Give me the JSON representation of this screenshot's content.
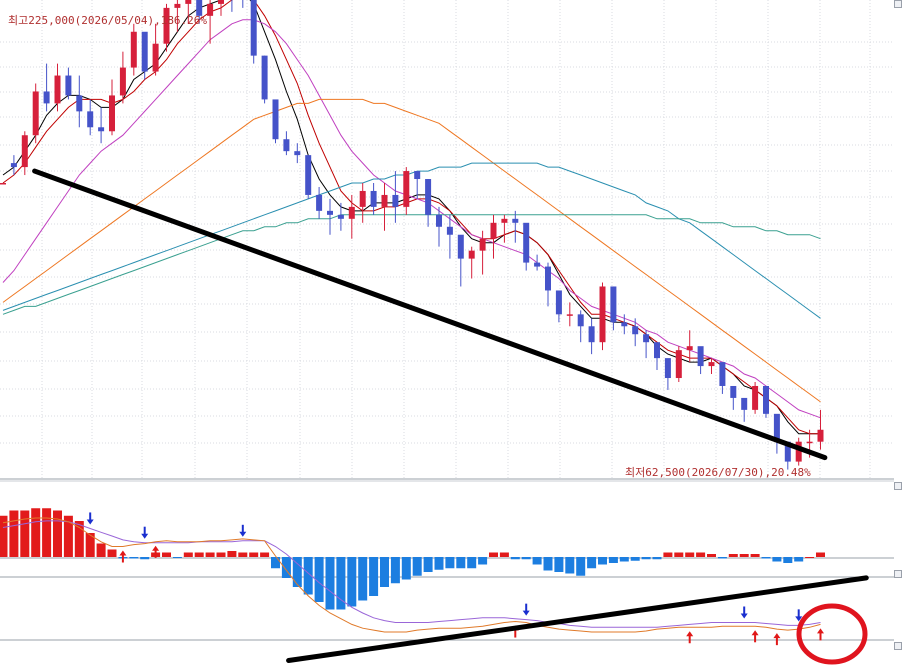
{
  "chart_data": [
    {
      "type": "candlestick",
      "annotations": {
        "high_label": "최고225,000(2026/05/04),186.26%",
        "low_label": "최저62,500(2026/07/30),20.48%"
      },
      "candles": [
        [
          0.0,
          0.0,
          0.0,
          0.0
        ],
        [
          0.05,
          0.07,
          0.02,
          0.04
        ],
        [
          0.04,
          0.13,
          0.02,
          0.12
        ],
        [
          0.12,
          0.25,
          0.1,
          0.23
        ],
        [
          0.23,
          0.3,
          0.18,
          0.2
        ],
        [
          0.2,
          0.3,
          0.18,
          0.27
        ],
        [
          0.27,
          0.29,
          0.21,
          0.22
        ],
        [
          0.22,
          0.27,
          0.14,
          0.18
        ],
        [
          0.18,
          0.21,
          0.12,
          0.14
        ],
        [
          0.14,
          0.19,
          0.1,
          0.13
        ],
        [
          0.13,
          0.26,
          0.12,
          0.22
        ],
        [
          0.22,
          0.33,
          0.2,
          0.29
        ],
        [
          0.29,
          0.4,
          0.27,
          0.38
        ],
        [
          0.38,
          0.37,
          0.26,
          0.28
        ],
        [
          0.28,
          0.4,
          0.27,
          0.35
        ],
        [
          0.35,
          0.45,
          0.33,
          0.44
        ],
        [
          0.44,
          0.48,
          0.38,
          0.45
        ],
        [
          0.45,
          0.49,
          0.4,
          0.47
        ],
        [
          0.47,
          0.5,
          0.4,
          0.42
        ],
        [
          0.42,
          0.46,
          0.35,
          0.45
        ],
        [
          0.45,
          0.56,
          0.42,
          0.51
        ],
        [
          0.51,
          0.51,
          0.43,
          0.48
        ],
        [
          0.48,
          0.5,
          0.44,
          0.46
        ],
        [
          0.46,
          0.44,
          0.3,
          0.32
        ],
        [
          0.32,
          0.32,
          0.2,
          0.21
        ],
        [
          0.21,
          0.19,
          0.1,
          0.11
        ],
        [
          0.11,
          0.13,
          0.07,
          0.08
        ],
        [
          0.08,
          0.1,
          0.05,
          0.07
        ],
        [
          0.07,
          0.07,
          -0.04,
          -0.03
        ],
        [
          -0.03,
          -0.01,
          -0.09,
          -0.07
        ],
        [
          -0.07,
          -0.04,
          -0.13,
          -0.08
        ],
        [
          -0.08,
          -0.05,
          -0.12,
          -0.09
        ],
        [
          -0.09,
          -0.03,
          -0.14,
          -0.06
        ],
        [
          -0.06,
          0.0,
          -0.1,
          -0.02
        ],
        [
          -0.02,
          0.0,
          -0.08,
          -0.06
        ],
        [
          -0.06,
          0.0,
          -0.12,
          -0.03
        ],
        [
          -0.03,
          0.03,
          -0.1,
          -0.06
        ],
        [
          -0.06,
          0.04,
          -0.08,
          0.03
        ],
        [
          0.03,
          0.02,
          -0.04,
          0.01
        ],
        [
          0.01,
          0.01,
          -0.11,
          -0.08
        ],
        [
          -0.08,
          -0.06,
          -0.16,
          -0.11
        ],
        [
          -0.11,
          -0.08,
          -0.19,
          -0.13
        ],
        [
          -0.13,
          -0.17,
          -0.26,
          -0.19
        ],
        [
          -0.19,
          -0.16,
          -0.24,
          -0.17
        ],
        [
          -0.17,
          -0.12,
          -0.23,
          -0.14
        ],
        [
          -0.14,
          -0.08,
          -0.19,
          -0.1
        ],
        [
          -0.1,
          -0.08,
          -0.15,
          -0.09
        ],
        [
          -0.09,
          -0.07,
          -0.15,
          -0.1
        ],
        [
          -0.1,
          -0.12,
          -0.22,
          -0.2
        ],
        [
          -0.2,
          -0.18,
          -0.22,
          -0.21
        ],
        [
          -0.21,
          -0.2,
          -0.31,
          -0.27
        ],
        [
          -0.27,
          -0.28,
          -0.35,
          -0.33
        ],
        [
          -0.33,
          -0.3,
          -0.36,
          -0.33
        ],
        [
          -0.33,
          -0.32,
          -0.4,
          -0.36
        ],
        [
          -0.36,
          -0.34,
          -0.43,
          -0.4
        ],
        [
          -0.4,
          -0.25,
          -0.42,
          -0.26
        ],
        [
          -0.26,
          -0.26,
          -0.37,
          -0.35
        ],
        [
          -0.35,
          -0.33,
          -0.38,
          -0.36
        ],
        [
          -0.36,
          -0.34,
          -0.41,
          -0.38
        ],
        [
          -0.38,
          -0.37,
          -0.44,
          -0.4
        ],
        [
          -0.4,
          -0.41,
          -0.47,
          -0.44
        ],
        [
          -0.44,
          -0.45,
          -0.52,
          -0.49
        ],
        [
          -0.49,
          -0.41,
          -0.5,
          -0.42
        ],
        [
          -0.42,
          -0.37,
          -0.45,
          -0.41
        ],
        [
          -0.41,
          -0.42,
          -0.48,
          -0.46
        ],
        [
          -0.46,
          -0.44,
          -0.48,
          -0.45
        ],
        [
          -0.45,
          -0.48,
          -0.53,
          -0.51
        ],
        [
          -0.51,
          -0.53,
          -0.57,
          -0.54
        ],
        [
          -0.54,
          -0.55,
          -0.6,
          -0.57
        ],
        [
          -0.57,
          -0.5,
          -0.58,
          -0.51
        ],
        [
          -0.51,
          -0.51,
          -0.59,
          -0.58
        ],
        [
          -0.58,
          -0.59,
          -0.68,
          -0.65
        ],
        [
          -0.65,
          -0.65,
          -0.72,
          -0.7
        ],
        [
          -0.7,
          -0.64,
          -0.71,
          -0.65
        ],
        [
          -0.65,
          -0.62,
          -0.69,
          -0.65
        ],
        [
          -0.65,
          -0.57,
          -0.67,
          -0.62
        ]
      ],
      "moving_averages": [
        {
          "color": "#000000",
          "values": [
            0.02,
            0.04,
            0.08,
            0.12,
            0.17,
            0.2,
            0.22,
            0.22,
            0.21,
            0.19,
            0.19,
            0.21,
            0.26,
            0.28,
            0.3,
            0.34,
            0.38,
            0.42,
            0.44,
            0.45,
            0.46,
            0.47,
            0.48,
            0.45,
            0.38,
            0.31,
            0.23,
            0.16,
            0.07,
            0.01,
            -0.03,
            -0.06,
            -0.07,
            -0.07,
            -0.05,
            -0.05,
            -0.05,
            -0.04,
            -0.03,
            -0.03,
            -0.04,
            -0.07,
            -0.11,
            -0.14,
            -0.15,
            -0.15,
            -0.13,
            -0.12,
            -0.13,
            -0.15,
            -0.18,
            -0.23,
            -0.28,
            -0.31,
            -0.34,
            -0.34,
            -0.35,
            -0.35,
            -0.36,
            -0.38,
            -0.41,
            -0.43,
            -0.44,
            -0.45,
            -0.45,
            -0.44,
            -0.46,
            -0.48,
            -0.51,
            -0.52,
            -0.54,
            -0.56,
            -0.6,
            -0.63,
            -0.63,
            -0.63
          ]
        },
        {
          "color": "#c00000",
          "values": [
            0.0,
            0.02,
            0.05,
            0.09,
            0.13,
            0.16,
            0.19,
            0.21,
            0.21,
            0.21,
            0.2,
            0.21,
            0.23,
            0.26,
            0.28,
            0.31,
            0.35,
            0.38,
            0.41,
            0.43,
            0.44,
            0.46,
            0.47,
            0.46,
            0.42,
            0.37,
            0.31,
            0.25,
            0.17,
            0.1,
            0.04,
            -0.02,
            -0.05,
            -0.07,
            -0.07,
            -0.06,
            -0.06,
            -0.05,
            -0.04,
            -0.04,
            -0.05,
            -0.07,
            -0.1,
            -0.13,
            -0.14,
            -0.14,
            -0.13,
            -0.12,
            -0.13,
            -0.15,
            -0.18,
            -0.22,
            -0.26,
            -0.3,
            -0.33,
            -0.33,
            -0.34,
            -0.35,
            -0.36,
            -0.38,
            -0.4,
            -0.42,
            -0.43,
            -0.44,
            -0.44,
            -0.44,
            -0.46,
            -0.48,
            -0.5,
            -0.52,
            -0.54,
            -0.56,
            -0.59,
            -0.62,
            -0.63,
            -0.63
          ]
        },
        {
          "color": "#c040c0",
          "values": [
            -0.25,
            -0.22,
            -0.18,
            -0.14,
            -0.1,
            -0.06,
            -0.02,
            0.02,
            0.05,
            0.08,
            0.1,
            0.12,
            0.15,
            0.18,
            0.21,
            0.24,
            0.27,
            0.3,
            0.33,
            0.36,
            0.38,
            0.4,
            0.41,
            0.41,
            0.4,
            0.38,
            0.35,
            0.31,
            0.27,
            0.22,
            0.17,
            0.12,
            0.08,
            0.05,
            0.02,
            0.0,
            -0.02,
            -0.03,
            -0.04,
            -0.05,
            -0.07,
            -0.09,
            -0.11,
            -0.13,
            -0.14,
            -0.15,
            -0.16,
            -0.17,
            -0.18,
            -0.2,
            -0.22,
            -0.24,
            -0.27,
            -0.29,
            -0.31,
            -0.32,
            -0.33,
            -0.34,
            -0.35,
            -0.37,
            -0.38,
            -0.4,
            -0.41,
            -0.42,
            -0.43,
            -0.44,
            -0.45,
            -0.46,
            -0.48,
            -0.49,
            -0.51,
            -0.53,
            -0.55,
            -0.57,
            -0.58,
            -0.59
          ]
        },
        {
          "color": "#ee7722",
          "values": [
            -0.3,
            -0.28,
            -0.26,
            -0.24,
            -0.22,
            -0.2,
            -0.18,
            -0.16,
            -0.14,
            -0.12,
            -0.1,
            -0.08,
            -0.06,
            -0.04,
            -0.02,
            0.0,
            0.02,
            0.04,
            0.06,
            0.08,
            0.1,
            0.12,
            0.14,
            0.16,
            0.17,
            0.18,
            0.19,
            0.2,
            0.2,
            0.21,
            0.21,
            0.21,
            0.21,
            0.21,
            0.2,
            0.2,
            0.19,
            0.18,
            0.17,
            0.16,
            0.15,
            0.13,
            0.11,
            0.09,
            0.07,
            0.05,
            0.03,
            0.01,
            -0.01,
            -0.03,
            -0.05,
            -0.07,
            -0.09,
            -0.11,
            -0.13,
            -0.15,
            -0.17,
            -0.19,
            -0.21,
            -0.23,
            -0.25,
            -0.27,
            -0.29,
            -0.31,
            -0.33,
            -0.35,
            -0.37,
            -0.39,
            -0.41,
            -0.43,
            -0.45,
            -0.47,
            -0.49,
            -0.51,
            -0.53,
            -0.55
          ]
        },
        {
          "color": "#2a8fb0",
          "values": [
            -0.32,
            -0.31,
            -0.3,
            -0.29,
            -0.28,
            -0.27,
            -0.26,
            -0.25,
            -0.24,
            -0.23,
            -0.22,
            -0.21,
            -0.2,
            -0.19,
            -0.18,
            -0.17,
            -0.16,
            -0.15,
            -0.14,
            -0.13,
            -0.12,
            -0.11,
            -0.1,
            -0.09,
            -0.08,
            -0.07,
            -0.06,
            -0.05,
            -0.04,
            -0.03,
            -0.02,
            -0.01,
            0.0,
            0.0,
            0.01,
            0.01,
            0.02,
            0.02,
            0.03,
            0.03,
            0.04,
            0.04,
            0.04,
            0.05,
            0.05,
            0.05,
            0.05,
            0.05,
            0.05,
            0.05,
            0.04,
            0.04,
            0.03,
            0.02,
            0.01,
            0.0,
            -0.01,
            -0.02,
            -0.03,
            -0.05,
            -0.06,
            -0.07,
            -0.09,
            -0.1,
            -0.12,
            -0.14,
            -0.16,
            -0.18,
            -0.2,
            -0.22,
            -0.24,
            -0.26,
            -0.28,
            -0.3,
            -0.32,
            -0.34
          ]
        },
        {
          "color": "#3aa090",
          "values": [
            -0.33,
            -0.32,
            -0.31,
            -0.31,
            -0.3,
            -0.29,
            -0.28,
            -0.27,
            -0.26,
            -0.25,
            -0.24,
            -0.23,
            -0.22,
            -0.21,
            -0.2,
            -0.19,
            -0.18,
            -0.17,
            -0.16,
            -0.15,
            -0.14,
            -0.13,
            -0.12,
            -0.12,
            -0.11,
            -0.11,
            -0.1,
            -0.1,
            -0.09,
            -0.09,
            -0.09,
            -0.08,
            -0.08,
            -0.08,
            -0.08,
            -0.08,
            -0.08,
            -0.08,
            -0.08,
            -0.08,
            -0.08,
            -0.08,
            -0.08,
            -0.08,
            -0.08,
            -0.08,
            -0.08,
            -0.08,
            -0.08,
            -0.08,
            -0.08,
            -0.08,
            -0.08,
            -0.08,
            -0.08,
            -0.08,
            -0.08,
            -0.08,
            -0.08,
            -0.08,
            -0.09,
            -0.09,
            -0.09,
            -0.09,
            -0.1,
            -0.1,
            -0.1,
            -0.11,
            -0.11,
            -0.11,
            -0.12,
            -0.12,
            -0.13,
            -0.13,
            -0.13,
            -0.14
          ]
        }
      ],
      "trendline": [
        [
          2.9,
          0.03
        ],
        [
          75.4,
          -0.69
        ]
      ]
    },
    {
      "type": "bar",
      "histogram": [
        0.55,
        0.62,
        0.62,
        0.65,
        0.65,
        0.62,
        0.55,
        0.48,
        0.32,
        0.18,
        0.1,
        -0.02,
        -0.02,
        -0.03,
        0.06,
        0.06,
        -0.01,
        0.06,
        0.06,
        0.06,
        0.06,
        0.08,
        0.06,
        0.06,
        0.06,
        -0.15,
        -0.28,
        -0.4,
        -0.5,
        -0.6,
        -0.7,
        -0.7,
        -0.66,
        -0.58,
        -0.52,
        -0.4,
        -0.35,
        -0.3,
        -0.25,
        -0.2,
        -0.17,
        -0.15,
        -0.15,
        -0.15,
        -0.1,
        0.06,
        0.06,
        -0.03,
        -0.03,
        -0.1,
        -0.18,
        -0.2,
        -0.22,
        -0.25,
        -0.15,
        -0.1,
        -0.08,
        -0.06,
        -0.05,
        -0.03,
        -0.03,
        0.06,
        0.06,
        0.06,
        0.06,
        0.04,
        -0.02,
        0.04,
        0.04,
        0.04,
        -0.02,
        -0.06,
        -0.08,
        -0.06,
        0.0,
        0.06
      ],
      "signal_line": [
        0.5,
        0.52,
        0.54,
        0.56,
        0.57,
        0.57,
        0.56,
        0.53,
        0.49,
        0.45,
        0.41,
        0.37,
        0.35,
        0.34,
        0.34,
        0.34,
        0.34,
        0.34,
        0.35,
        0.35,
        0.35,
        0.35,
        0.36,
        0.36,
        0.36,
        0.3,
        0.22,
        0.12,
        0.02,
        -0.08,
        -0.17,
        -0.26,
        -0.34,
        -0.4,
        -0.45,
        -0.48,
        -0.5,
        -0.5,
        -0.5,
        -0.5,
        -0.49,
        -0.48,
        -0.47,
        -0.46,
        -0.45,
        -0.45,
        -0.45,
        -0.46,
        -0.47,
        -0.48,
        -0.5,
        -0.51,
        -0.53,
        -0.54,
        -0.55,
        -0.55,
        -0.55,
        -0.55,
        -0.55,
        -0.55,
        -0.55,
        -0.54,
        -0.53,
        -0.52,
        -0.51,
        -0.5,
        -0.5,
        -0.5,
        -0.5,
        -0.5,
        -0.51,
        -0.52,
        -0.53,
        -0.53,
        -0.52,
        -0.5
      ],
      "osc_line": [
        0.55,
        0.57,
        0.59,
        0.6,
        0.6,
        0.59,
        0.56,
        0.5,
        0.42,
        0.35,
        0.3,
        0.3,
        0.32,
        0.33,
        0.35,
        0.36,
        0.35,
        0.35,
        0.35,
        0.36,
        0.36,
        0.37,
        0.38,
        0.37,
        0.36,
        0.2,
        0.05,
        -0.1,
        -0.22,
        -0.32,
        -0.4,
        -0.46,
        -0.52,
        -0.56,
        -0.58,
        -0.6,
        -0.6,
        -0.6,
        -0.58,
        -0.57,
        -0.56,
        -0.56,
        -0.56,
        -0.55,
        -0.54,
        -0.52,
        -0.5,
        -0.49,
        -0.5,
        -0.53,
        -0.55,
        -0.57,
        -0.58,
        -0.59,
        -0.6,
        -0.6,
        -0.6,
        -0.6,
        -0.6,
        -0.59,
        -0.57,
        -0.56,
        -0.55,
        -0.55,
        -0.55,
        -0.55,
        -0.54,
        -0.54,
        -0.54,
        -0.54,
        -0.55,
        -0.57,
        -0.58,
        -0.57,
        -0.55,
        -0.52
      ],
      "signals_up": [
        11,
        14,
        47,
        63,
        69,
        71,
        75
      ],
      "signals_down": [
        8,
        13,
        22,
        48,
        68,
        73
      ],
      "trendline": [
        [
          26.2,
          -0.9
        ],
        [
          79.2,
          -0.03
        ]
      ]
    }
  ]
}
